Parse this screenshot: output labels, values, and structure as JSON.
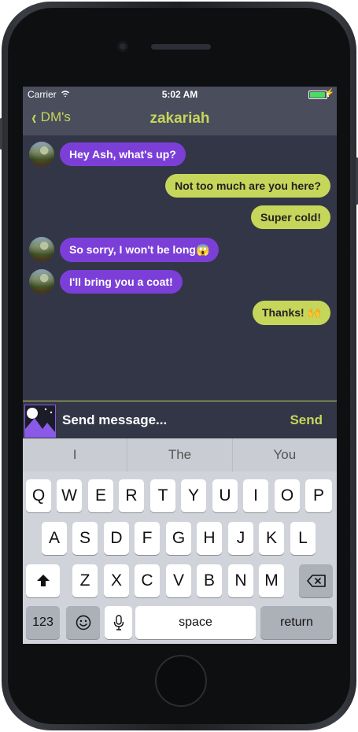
{
  "status_bar": {
    "carrier": "Carrier",
    "time": "5:02 AM"
  },
  "nav": {
    "back_label": "DM's",
    "title": "zakariah"
  },
  "messages": [
    {
      "direction": "incoming",
      "text": "Hey Ash, what's up?"
    },
    {
      "direction": "outgoing",
      "text": "Not too much are you here?"
    },
    {
      "direction": "outgoing",
      "text": "Super cold!"
    },
    {
      "direction": "incoming",
      "text": "So sorry, I won't be long😱"
    },
    {
      "direction": "incoming",
      "text": "I'll bring you a coat!"
    },
    {
      "direction": "outgoing",
      "text": "Thanks! 🙌"
    }
  ],
  "composer": {
    "placeholder": "Send message...",
    "send_label": "Send"
  },
  "keyboard": {
    "predictions": [
      "I",
      "The",
      "You"
    ],
    "row1": [
      "Q",
      "W",
      "E",
      "R",
      "T",
      "Y",
      "U",
      "I",
      "O",
      "P"
    ],
    "row2": [
      "A",
      "S",
      "D",
      "F",
      "G",
      "H",
      "J",
      "K",
      "L"
    ],
    "row3": [
      "Z",
      "X",
      "C",
      "V",
      "B",
      "N",
      "M"
    ],
    "numbers_label": "123",
    "space_label": "space",
    "return_label": "return"
  },
  "colors": {
    "accent": "#c5d65a",
    "incoming_bubble": "#7b3fd8",
    "background": "#333647",
    "nav": "#4a4d5c"
  }
}
